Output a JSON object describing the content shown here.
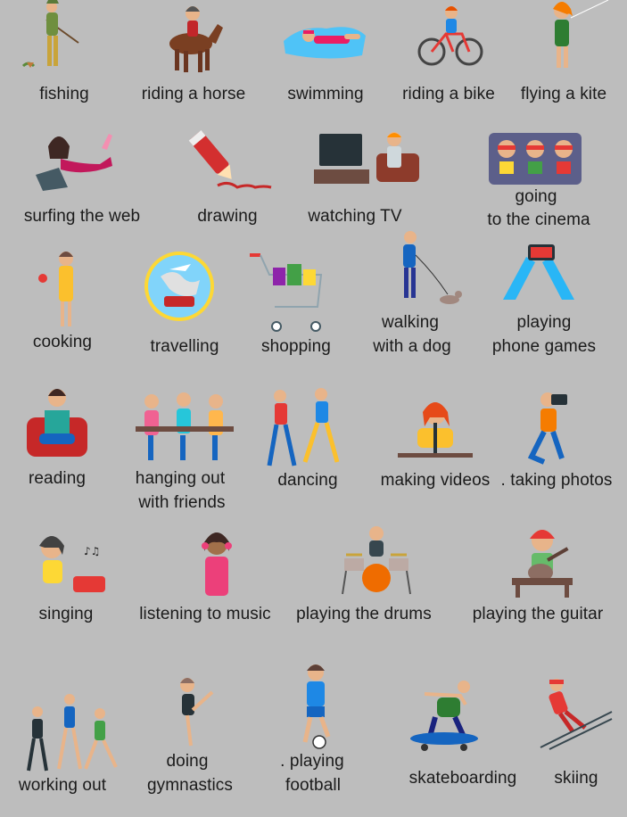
{
  "labels": {
    "fishing": "fishing",
    "riding_horse": "riding a horse",
    "swimming": "swimming",
    "riding_bike": "riding a bike",
    "flying_kite": "flying a kite",
    "surfing_web": "surfing the web",
    "drawing": "drawing",
    "watching_tv": "watching TV",
    "cinema_1": "going",
    "cinema_2": "to the cinema",
    "cooking": "cooking",
    "travelling": "travelling",
    "shopping": "shopping",
    "walking_1": "walking",
    "walking_2": "with a dog",
    "phone_1": "playing",
    "phone_2": "phone games",
    "reading": "reading",
    "hanging_1": "hanging out",
    "hanging_2": "with friends",
    "dancing": "dancing",
    "making_videos": "making videos",
    "taking_photos": ". taking photos",
    "singing": "singing",
    "listening": "listening to music",
    "drums": "playing the drums",
    "guitar": "playing the guitar",
    "working_out": "working out",
    "gym_1": "doing",
    "gym_2": "gymnastics",
    "football_1": ". playing",
    "football_2": "football",
    "skateboarding": "skateboarding",
    "skiing": "skiing"
  },
  "colors": {
    "background": "#bdbdbd",
    "text": "#1a1a1a"
  }
}
